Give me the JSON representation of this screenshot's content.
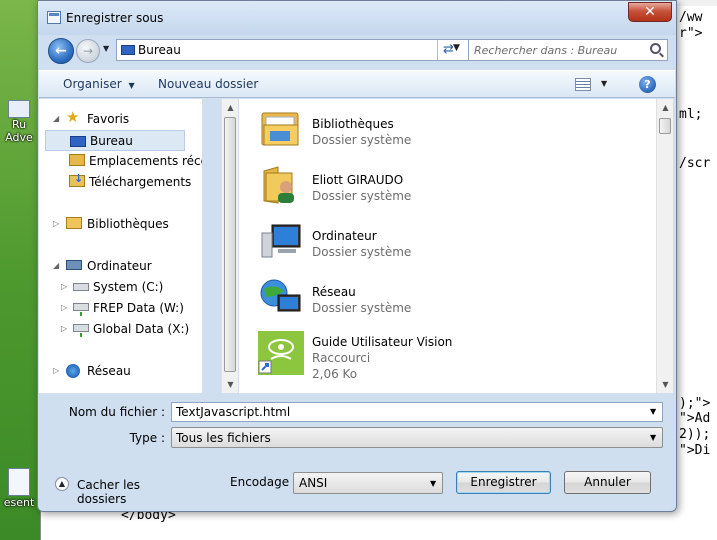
{
  "background": {
    "desktop_labels": [
      "Ru",
      "Adve",
      "esent"
    ],
    "code_lines": [
      "/ww",
      "r\">",
      "ml;",
      "/scr",
      ");\">",
      "\">Ad",
      "2));",
      "\">Di",
      "</body>"
    ]
  },
  "dialog": {
    "title": "Enregistrer sous",
    "close_glyph": "✕",
    "address": {
      "location": "Bureau",
      "search_placeholder": "Rechercher dans : Bureau"
    },
    "toolbar": {
      "organize": "Organiser",
      "new_folder": "Nouveau dossier",
      "help_glyph": "?"
    },
    "nav": {
      "favorites_header": "Favoris",
      "favorites": [
        {
          "label": "Bureau",
          "icon": "desktop-icon"
        },
        {
          "label": "Emplacements récents",
          "icon": "recent-places-icon"
        },
        {
          "label": "Téléchargements",
          "icon": "downloads-icon"
        }
      ],
      "libraries": "Bibliothèques",
      "computer": "Ordinateur",
      "drives": [
        {
          "label": "System (C:)",
          "icon": "drive-icon"
        },
        {
          "label": "FREP Data (W:)",
          "icon": "network-drive-icon"
        },
        {
          "label": "Global Data (X:)",
          "icon": "network-drive-icon"
        }
      ],
      "network": "Réseau"
    },
    "files": [
      {
        "name": "Bibliothèques",
        "type": "Dossier système",
        "size": "",
        "icon": "libraries-folder-icon"
      },
      {
        "name": "Eliott GIRAUDO",
        "type": "Dossier système",
        "size": "",
        "icon": "user-folder-icon"
      },
      {
        "name": "Ordinateur",
        "type": "Dossier système",
        "size": "",
        "icon": "computer-icon"
      },
      {
        "name": "Réseau",
        "type": "Dossier système",
        "size": "",
        "icon": "network-icon"
      },
      {
        "name": "Guide Utilisateur Vision",
        "type": "Raccourci",
        "size": "2,06 Ko",
        "icon": "shortcut-icon"
      }
    ],
    "form": {
      "filename_label": "Nom du fichier :",
      "filename_value": "TextJavascript.html",
      "type_label": "Type :",
      "type_value": "Tous les fichiers",
      "hide_folders": "Cacher les dossiers",
      "encoding_label": "Encodage :",
      "encoding_value": "ANSI",
      "save": "Enregistrer",
      "cancel": "Annuler"
    },
    "colors": {
      "accent": "#2f64c2",
      "selection": "#dde8f5",
      "frame": "#cfdff0",
      "close": "#c7523c"
    }
  }
}
